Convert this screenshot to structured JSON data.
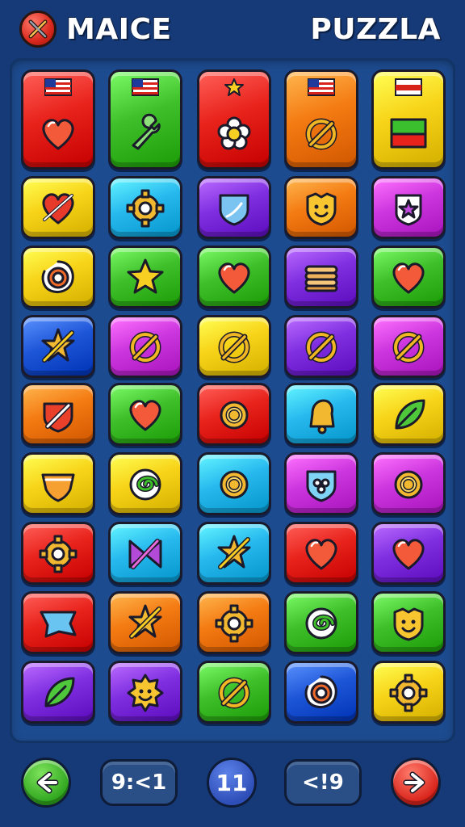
{
  "header": {
    "left_title": "MAICE",
    "right_title": "PUZZLA",
    "logo_icon": "crossed-wrench-icon"
  },
  "colors": {
    "red": "#e8231c",
    "green": "#3fbf2a",
    "orange": "#f47a12",
    "yellow": "#f7d318",
    "blue": "#1e56d8",
    "cyan": "#27b9ee",
    "purple": "#7f2fe0",
    "magenta": "#cc36de",
    "background": "#163a78"
  },
  "board": {
    "rows": [
      [
        {
          "color": "red",
          "icon": "heart-icon",
          "flag": "us-flag-icon"
        },
        {
          "color": "green",
          "icon": "wrench-icon",
          "flag": "us-flag-icon"
        },
        {
          "color": "red",
          "icon": "flower-icon",
          "flag": "star-icon"
        },
        {
          "color": "orange",
          "icon": "slashed-circle-icon",
          "flag": "us-flag-icon"
        },
        {
          "color": "yellow",
          "icon": "green-red-flag-icon",
          "flag": "red-stripe-flag-icon"
        }
      ],
      [
        {
          "color": "yellow",
          "icon": "broken-heart-icon"
        },
        {
          "color": "cyan",
          "icon": "gear-icon"
        },
        {
          "color": "purple",
          "icon": "shield-icon"
        },
        {
          "color": "orange",
          "icon": "smiley-shield-icon"
        },
        {
          "color": "magenta",
          "icon": "star-badge-icon"
        }
      ],
      [
        {
          "color": "yellow",
          "icon": "target-icon"
        },
        {
          "color": "green",
          "icon": "star-icon"
        },
        {
          "color": "green",
          "icon": "heart-icon"
        },
        {
          "color": "purple",
          "icon": "pancake-stack-icon"
        },
        {
          "color": "green",
          "icon": "heart-icon"
        }
      ],
      [
        {
          "color": "blue",
          "icon": "crossed-star-icon"
        },
        {
          "color": "magenta",
          "icon": "slashed-circle-icon"
        },
        {
          "color": "yellow",
          "icon": "slashed-circle-icon"
        },
        {
          "color": "purple",
          "icon": "slashed-circle-icon"
        },
        {
          "color": "magenta",
          "icon": "slashed-circle-icon"
        }
      ],
      [
        {
          "color": "orange",
          "icon": "slashed-shield-icon"
        },
        {
          "color": "green",
          "icon": "heart-icon"
        },
        {
          "color": "red",
          "icon": "ring-icon"
        },
        {
          "color": "cyan",
          "icon": "bell-icon"
        },
        {
          "color": "yellow",
          "icon": "leaf-icon"
        }
      ],
      [
        {
          "color": "yellow",
          "icon": "heart-badge-icon"
        },
        {
          "color": "yellow",
          "icon": "swirl-icon"
        },
        {
          "color": "cyan",
          "icon": "ring-icon"
        },
        {
          "color": "magenta",
          "icon": "flower-badge-icon"
        },
        {
          "color": "magenta",
          "icon": "ring-icon"
        }
      ],
      [
        {
          "color": "red",
          "icon": "gear-icon"
        },
        {
          "color": "cyan",
          "icon": "bowtie-icon"
        },
        {
          "color": "cyan",
          "icon": "crossed-star-icon"
        },
        {
          "color": "red",
          "icon": "heart-icon"
        },
        {
          "color": "purple",
          "icon": "heart-icon"
        }
      ],
      [
        {
          "color": "red",
          "icon": "chat-bubble-icon"
        },
        {
          "color": "orange",
          "icon": "crossed-star-icon"
        },
        {
          "color": "orange",
          "icon": "gear-icon"
        },
        {
          "color": "green",
          "icon": "swirl-icon"
        },
        {
          "color": "green",
          "icon": "smiley-shield-icon"
        }
      ],
      [
        {
          "color": "purple",
          "icon": "leaf-icon"
        },
        {
          "color": "purple",
          "icon": "smiley-flower-icon"
        },
        {
          "color": "green",
          "icon": "slashed-circle-icon"
        },
        {
          "color": "blue",
          "icon": "target-icon"
        },
        {
          "color": "yellow",
          "icon": "gear-icon"
        }
      ]
    ]
  },
  "footer": {
    "back_icon": "arrow-left-icon",
    "forward_icon": "arrow-right-icon",
    "left_counter": "9:<1",
    "center_counter": "11",
    "right_counter": "<!9"
  }
}
